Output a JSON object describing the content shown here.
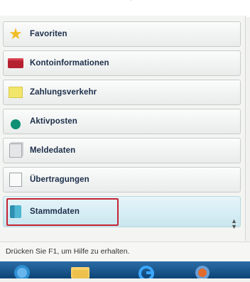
{
  "nav": {
    "items": [
      {
        "label": "Favoriten",
        "icon": "star-icon"
      },
      {
        "label": "Kontoinformationen",
        "icon": "wallet-icon"
      },
      {
        "label": "Zahlungsverkehr",
        "icon": "payment-icon"
      },
      {
        "label": "Aktivposten",
        "icon": "green-ball-icon"
      },
      {
        "label": "Meldedaten",
        "icon": "report-icon"
      },
      {
        "label": "Übertragungen",
        "icon": "transfer-icon"
      },
      {
        "label": "Stammdaten",
        "icon": "master-data-icon"
      }
    ],
    "selected": "Stammdaten"
  },
  "status": {
    "text": "Drücken Sie F1, um Hilfe zu erhalten."
  },
  "taskbar": {
    "items": [
      "start-orb-icon",
      "explorer-icon",
      "ie-icon",
      "media-icon"
    ]
  },
  "colors": {
    "selection_outline": "#c52433",
    "selected_bg": "#c9e6ef",
    "taskbar": "#0d4375"
  }
}
